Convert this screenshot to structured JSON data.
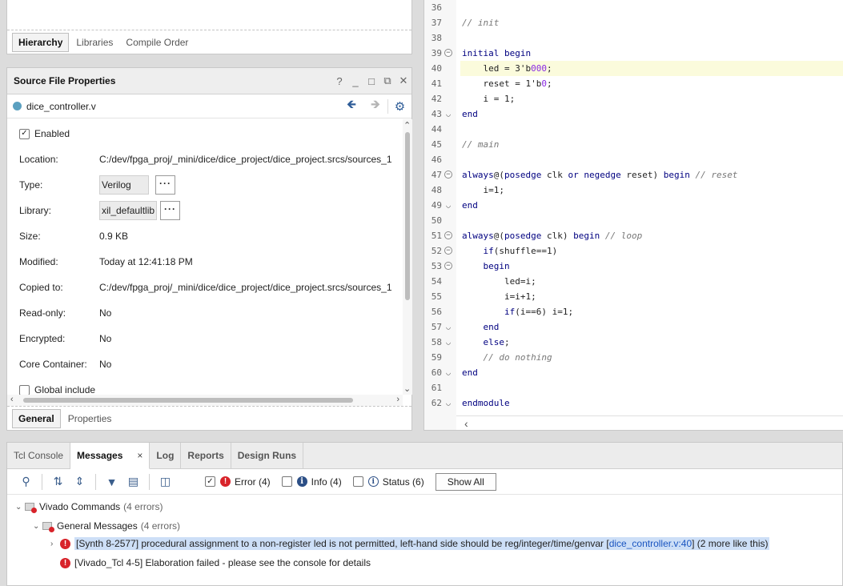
{
  "hierarchy_panel": {
    "tabs": [
      "Hierarchy",
      "Libraries",
      "Compile Order"
    ]
  },
  "sfp": {
    "title": "Source File Properties",
    "header_controls": [
      "?",
      "_",
      "□",
      "⧉",
      "✕"
    ],
    "file_name": "dice_controller.v",
    "enabled_label": "Enabled",
    "rows": {
      "location": {
        "label": "Location:",
        "value": "C:/dev/fpga_proj/_mini/dice/dice_project/dice_project.srcs/sources_1"
      },
      "type": {
        "label": "Type:",
        "value": "Verilog"
      },
      "library": {
        "label": "Library:",
        "value": "xil_defaultlib"
      },
      "size": {
        "label": "Size:",
        "value": "0.9 KB"
      },
      "modified": {
        "label": "Modified:",
        "value": "Today at 12:41:18 PM"
      },
      "copied_to": {
        "label": "Copied to:",
        "value": "C:/dev/fpga_proj/_mini/dice/dice_project/dice_project.srcs/sources_1"
      },
      "read_only": {
        "label": "Read-only:",
        "value": "No"
      },
      "encrypted": {
        "label": "Encrypted:",
        "value": "No"
      },
      "core_container": {
        "label": "Core Container:",
        "value": "No"
      }
    },
    "global_include_label": "Global include",
    "dots": "···",
    "tabs": [
      "General",
      "Properties"
    ]
  },
  "editor": {
    "lines": [
      {
        "n": "36",
        "fold": "",
        "html": ""
      },
      {
        "n": "37",
        "fold": "",
        "html": "<span class=\"cm\">// init</span>"
      },
      {
        "n": "38",
        "fold": "",
        "html": ""
      },
      {
        "n": "39",
        "fold": "open",
        "html": "<span class=\"kw\">initial begin</span>"
      },
      {
        "n": "40",
        "fold": "",
        "html": "    led = 3'b<span class=\"num\">000</span>;",
        "hl": true
      },
      {
        "n": "41",
        "fold": "",
        "html": "    reset = 1'b<span class=\"num\">0</span>;"
      },
      {
        "n": "42",
        "fold": "",
        "html": "    i = 1;"
      },
      {
        "n": "43",
        "fold": "close",
        "html": "<span class=\"kw\">end</span>"
      },
      {
        "n": "44",
        "fold": "",
        "html": ""
      },
      {
        "n": "45",
        "fold": "",
        "html": "<span class=\"cm\">// main</span>"
      },
      {
        "n": "46",
        "fold": "",
        "html": ""
      },
      {
        "n": "47",
        "fold": "open",
        "html": "<span class=\"kw\">always</span>@(<span class=\"kw\">posedge</span> clk <span class=\"kw\">or negedge</span> reset) <span class=\"kw\">begin</span> <span class=\"cm\">// reset</span>"
      },
      {
        "n": "48",
        "fold": "",
        "html": "    i=1;"
      },
      {
        "n": "49",
        "fold": "close",
        "html": "<span class=\"kw\">end</span>"
      },
      {
        "n": "50",
        "fold": "",
        "html": ""
      },
      {
        "n": "51",
        "fold": "open",
        "html": "<span class=\"kw\">always</span>@(<span class=\"kw\">posedge</span> clk) <span class=\"kw\">begin</span> <span class=\"cm\">// loop</span>"
      },
      {
        "n": "52",
        "fold": "open",
        "html": "    <span class=\"kw\">if</span>(shuffle==1)"
      },
      {
        "n": "53",
        "fold": "open",
        "html": "    <span class=\"kw\">begin</span>"
      },
      {
        "n": "54",
        "fold": "",
        "html": "        led=i;"
      },
      {
        "n": "55",
        "fold": "",
        "html": "        i=i+1;"
      },
      {
        "n": "56",
        "fold": "",
        "html": "        <span class=\"kw\">if</span>(i==6) i=1;"
      },
      {
        "n": "57",
        "fold": "close",
        "html": "    <span class=\"kw\">end</span>"
      },
      {
        "n": "58",
        "fold": "close",
        "html": "    <span class=\"kw\">else</span>;"
      },
      {
        "n": "59",
        "fold": "",
        "html": "    <span class=\"cm\">// do nothing</span>"
      },
      {
        "n": "60",
        "fold": "close",
        "html": "<span class=\"kw\">end</span>"
      },
      {
        "n": "61",
        "fold": "",
        "html": ""
      },
      {
        "n": "62",
        "fold": "close",
        "html": "<span class=\"kw\">endmodule</span>"
      }
    ]
  },
  "messages": {
    "tabs": [
      {
        "label": "Tcl Console",
        "active": false
      },
      {
        "label": "Messages",
        "active": true,
        "close": "×"
      },
      {
        "label": "Log",
        "active": false
      },
      {
        "label": "Reports",
        "active": false
      },
      {
        "label": "Design Runs",
        "active": false
      }
    ],
    "filters": {
      "error": {
        "label": "Error (4)",
        "checked": true
      },
      "info": {
        "label": "Info (4)",
        "checked": false
      },
      "status": {
        "label": "Status (6)",
        "checked": false
      }
    },
    "show_all": "Show All",
    "tree": {
      "group": {
        "label": "Vivado Commands",
        "count": "(4 errors)"
      },
      "subgroup": {
        "label": "General Messages",
        "count": "(4 errors)"
      },
      "msg1": {
        "text": "[Synth 8-2577] procedural assignment to a non-register led is not permitted, left-hand side should be reg/integer/time/genvar [",
        "link": "dice_controller.v:40",
        "suffix": "] (2 more like this)"
      },
      "msg2": {
        "text": "[Vivado_Tcl 4-5] Elaboration failed - please see the console for details"
      }
    }
  },
  "colors": {
    "error": "#d8232a",
    "selection": "#cddff7",
    "link": "#1a55c0",
    "keyword": "#000080"
  }
}
